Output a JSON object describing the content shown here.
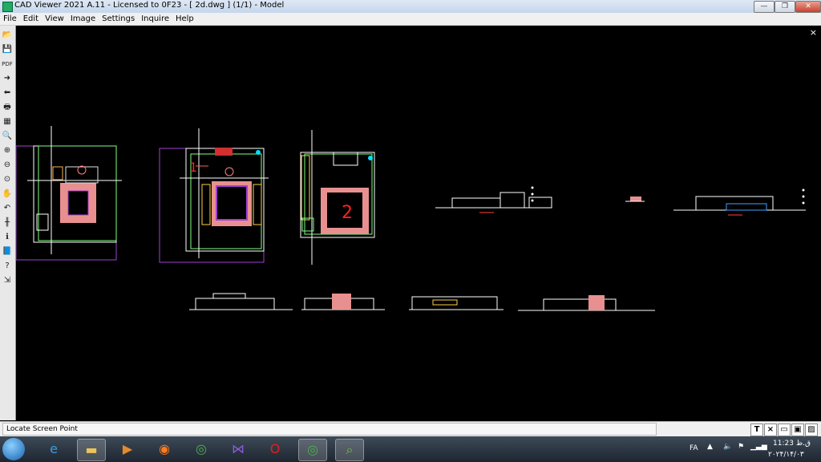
{
  "window": {
    "title": "CAD Viewer 2021 A.11 - Licensed to 0F23  -  [ 2d.dwg ] (1/1)  -  Model"
  },
  "menu": [
    "File",
    "Edit",
    "View",
    "Image",
    "Settings",
    "Inquire",
    "Help"
  ],
  "toolbar": {
    "items": [
      {
        "name": "open-file-icon",
        "glyph": "📂"
      },
      {
        "name": "save-icon",
        "glyph": "💾"
      },
      {
        "name": "pdf-export-icon",
        "glyph": "PDF"
      },
      {
        "name": "forward-arrow-icon",
        "glyph": "➜"
      },
      {
        "name": "back-arrow-icon",
        "glyph": "⬅"
      },
      {
        "name": "print-icon",
        "glyph": "🖶"
      },
      {
        "name": "layers-icon",
        "glyph": "▦"
      },
      {
        "name": "zoom-icon",
        "glyph": "🔍"
      },
      {
        "name": "zoom-in-icon",
        "glyph": "⊕"
      },
      {
        "name": "zoom-out-icon",
        "glyph": "⊖"
      },
      {
        "name": "zoom-window-icon",
        "glyph": "⊙"
      },
      {
        "name": "pan-hand-icon",
        "glyph": "✋"
      },
      {
        "name": "undo-icon",
        "glyph": "↶"
      },
      {
        "name": "measure-icon",
        "glyph": "╫"
      },
      {
        "name": "info-icon",
        "glyph": "ℹ"
      },
      {
        "name": "book-icon",
        "glyph": "📘"
      },
      {
        "name": "help-icon",
        "glyph": "?"
      },
      {
        "name": "exit-icon",
        "glyph": "⇲"
      }
    ]
  },
  "drawing": {
    "label_1": "1",
    "label_2": "2"
  },
  "status": {
    "text": "Locate Screen Point"
  },
  "statusbar_buttons": [
    {
      "name": "text-tool-button",
      "glyph": "T"
    },
    {
      "name": "close-tool-button",
      "glyph": "×"
    },
    {
      "name": "window-button",
      "glyph": "▭"
    },
    {
      "name": "display-button",
      "glyph": "▣"
    },
    {
      "name": "color-button",
      "glyph": "▨"
    }
  ],
  "taskbar": {
    "apps": [
      {
        "name": "ie-icon",
        "glyph": "e",
        "color": "#3a9bdc"
      },
      {
        "name": "explorer-icon",
        "glyph": "▬",
        "color": "#e9c45a"
      },
      {
        "name": "media-player-icon",
        "glyph": "▶",
        "color": "#e38b2c"
      },
      {
        "name": "firefox-icon",
        "glyph": "◉",
        "color": "#ff7a1a"
      },
      {
        "name": "chrome-icon",
        "glyph": "◎",
        "color": "#4caf50"
      },
      {
        "name": "visual-studio-icon",
        "glyph": "⋈",
        "color": "#8e5bd6"
      },
      {
        "name": "opera-icon",
        "glyph": "O",
        "color": "#e02020"
      },
      {
        "name": "chrome-profile-icon",
        "glyph": "◎",
        "color": "#4caf50"
      },
      {
        "name": "cad-viewer-icon",
        "glyph": "⌕",
        "color": "#6fc23a"
      }
    ],
    "language": "FA",
    "time": "11:23 ق.ظ",
    "date": "۲۰۲۴/۱۴/۰۳"
  }
}
